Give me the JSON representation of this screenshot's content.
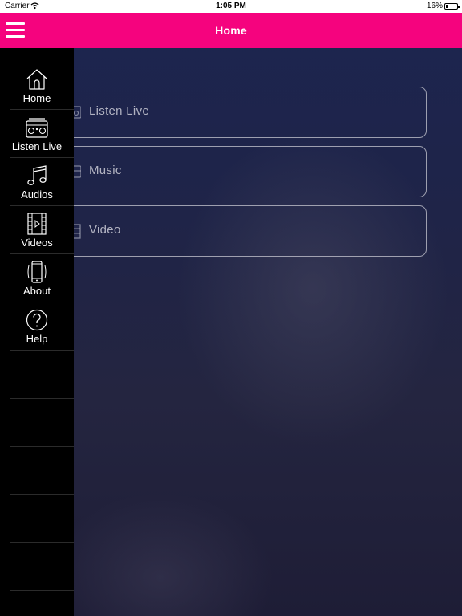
{
  "status_bar": {
    "carrier": "Carrier",
    "time": "1:05 PM",
    "battery_percent_text": "16%",
    "battery_level": 0.16,
    "wifi_icon": "wifi-icon",
    "battery_icon": "battery-icon"
  },
  "nav_bar": {
    "title": "Home",
    "menu_icon": "hamburger-menu-icon",
    "color": "#f5037e"
  },
  "main": {
    "buttons": [
      {
        "label": "Listen Live",
        "icon": "radio-icon"
      },
      {
        "label": "Music",
        "icon": "music-icon"
      },
      {
        "label": "Video",
        "icon": "film-icon"
      }
    ]
  },
  "sidebar": {
    "items": [
      {
        "label": "Home",
        "icon": "home-icon"
      },
      {
        "label": "Listen Live",
        "icon": "radio-icon"
      },
      {
        "label": "Audios",
        "icon": "music-notes-icon"
      },
      {
        "label": "Videos",
        "icon": "video-film-icon"
      },
      {
        "label": "About",
        "icon": "phone-icon"
      },
      {
        "label": "Help",
        "icon": "help-icon"
      }
    ]
  }
}
